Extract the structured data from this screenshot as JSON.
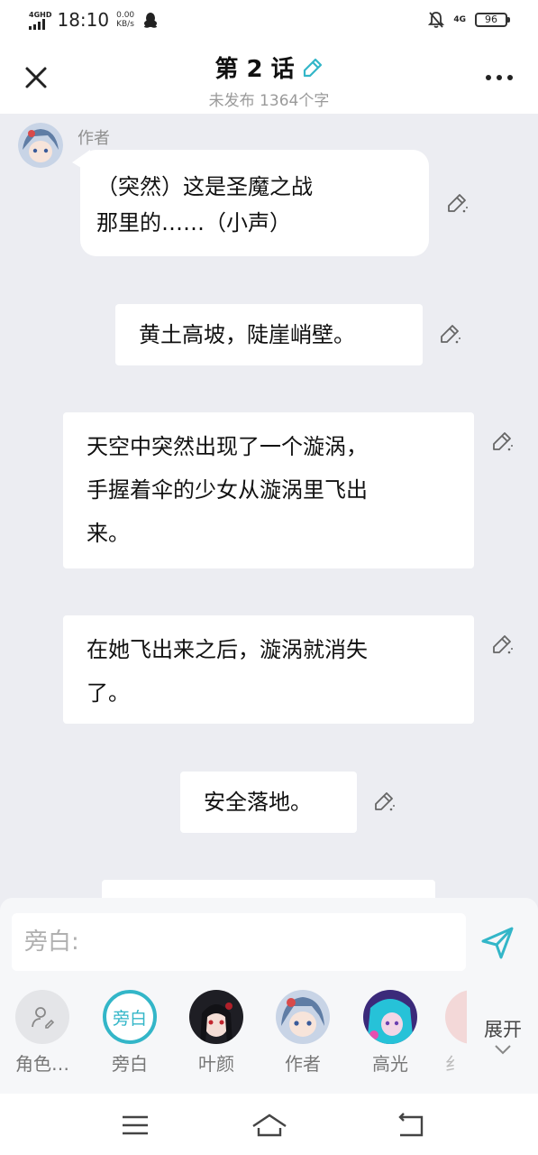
{
  "status_bar": {
    "network_type": "4GHD",
    "time": "18:10",
    "speed_value": "0.00",
    "speed_unit": "KB/s",
    "mobile_data": "4G",
    "battery": "96"
  },
  "header": {
    "title": "第 2 话",
    "subtitle": "未发布 1364个字"
  },
  "chat": {
    "author_label": "作者",
    "messages": [
      {
        "line1": "（突然）这是圣魔之战",
        "line2": "那里的……（小声）"
      },
      {
        "line1": "黄土高坡，陡崖峭壁。"
      },
      {
        "line1": "天空中突然出现了一个漩涡，",
        "line2": "手握着伞的少女从漩涡里飞出",
        "line3": "来。"
      },
      {
        "line1": "在她飞出来之后，漩涡就消失",
        "line2": "了。"
      },
      {
        "line1": "安全落地。"
      }
    ]
  },
  "composer": {
    "placeholder": "旁白:",
    "characters": [
      {
        "label": "角色…"
      },
      {
        "label": "旁白",
        "badge": "旁白"
      },
      {
        "label": "叶颜"
      },
      {
        "label": "作者"
      },
      {
        "label": "高光"
      },
      {
        "label": "纟"
      }
    ],
    "expand_label": "展开"
  },
  "colors": {
    "accent": "#33b6c8",
    "background": "#ecedf2",
    "bubble": "#ffffff"
  }
}
